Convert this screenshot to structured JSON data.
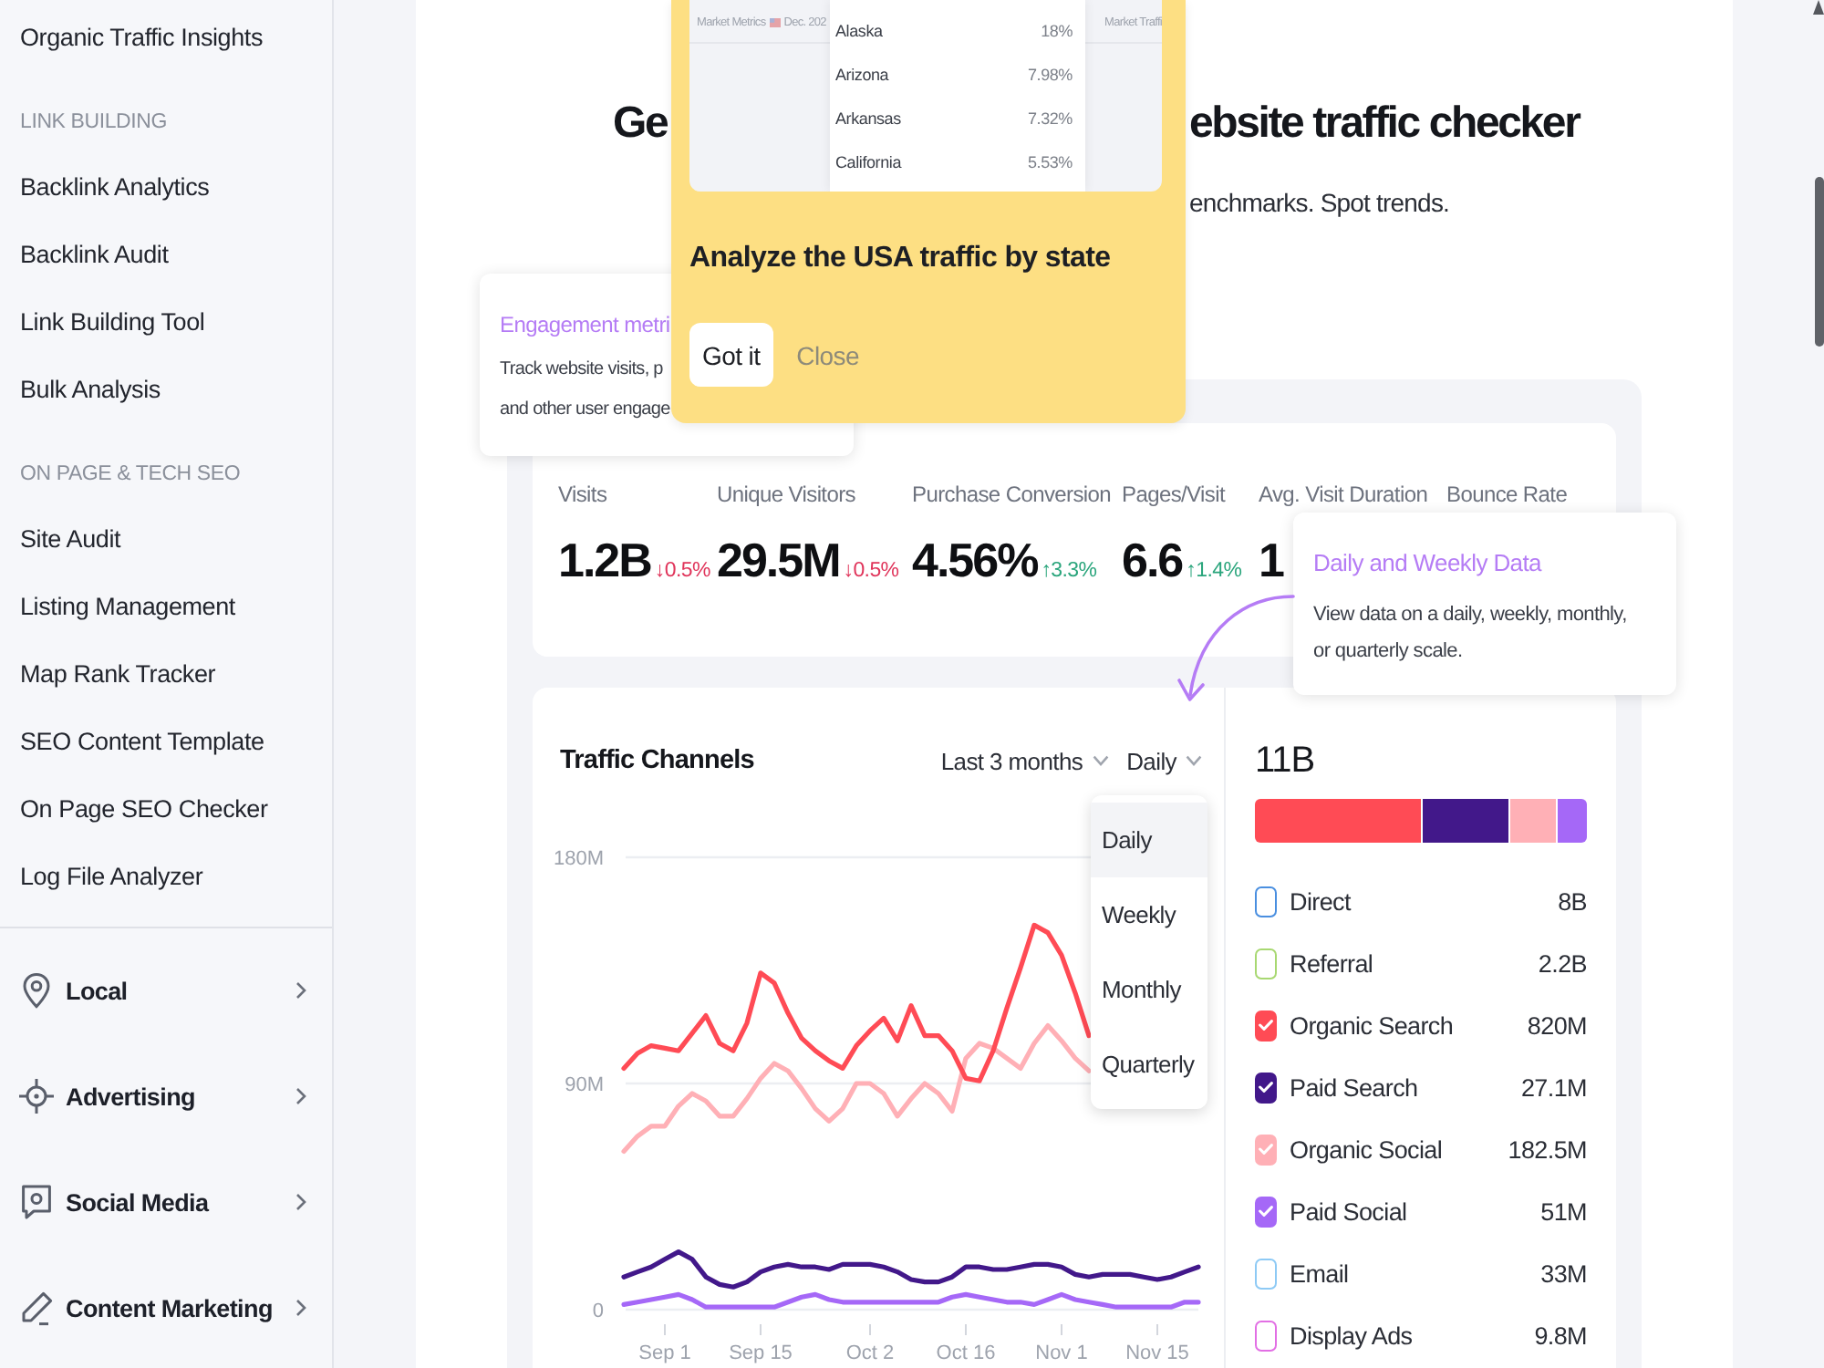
{
  "sidebar": {
    "items": [
      {
        "kind": "link",
        "label": "Organic Traffic Insights"
      },
      {
        "kind": "heading",
        "label": "LINK BUILDING"
      },
      {
        "kind": "link",
        "label": "Backlink Analytics"
      },
      {
        "kind": "link",
        "label": "Backlink Audit"
      },
      {
        "kind": "link",
        "label": "Link Building Tool"
      },
      {
        "kind": "link",
        "label": "Bulk Analysis"
      },
      {
        "kind": "heading",
        "label": "ON PAGE & TECH SEO"
      },
      {
        "kind": "link",
        "label": "Site Audit"
      },
      {
        "kind": "link",
        "label": "Listing Management"
      },
      {
        "kind": "link",
        "label": "Map Rank Tracker"
      },
      {
        "kind": "link",
        "label": "SEO Content Template"
      },
      {
        "kind": "link",
        "label": "On Page SEO Checker"
      },
      {
        "kind": "link",
        "label": "Log File Analyzer"
      }
    ],
    "categories": [
      {
        "label": "Local",
        "expanded": false
      },
      {
        "label": "Advertising",
        "expanded": false
      },
      {
        "label": "Social Media",
        "expanded": false
      },
      {
        "label": "Content Marketing",
        "expanded": false
      }
    ]
  },
  "header": {
    "title_start": "Ge",
    "title_end": "ebsite traffic checker",
    "subtitle_end": "enchmarks. Spot trends."
  },
  "onboarding_popup": {
    "preview": {
      "header_left": "Market Metrics",
      "header_date": "Dec. 202",
      "header_right": "Market Traffi",
      "states": [
        {
          "name": "Alaska",
          "share": "18%"
        },
        {
          "name": "Arizona",
          "share": "7.98%"
        },
        {
          "name": "Arkansas",
          "share": "7.32%"
        },
        {
          "name": "California",
          "share": "5.53%"
        }
      ]
    },
    "title": "Analyze the USA traffic by state",
    "primary_button": "Got it",
    "secondary_button": "Close"
  },
  "engagement_tooltip": {
    "title": "Engagement metri",
    "lines": [
      "Track website visits, p",
      "and other user engage"
    ]
  },
  "metrics": [
    {
      "label": "Visits",
      "value": "1.2B",
      "change": "↓0.5%",
      "increase": false
    },
    {
      "label": "Unique Visitors",
      "value": "29.5M",
      "change": "↓0.5%",
      "increase": false
    },
    {
      "label": "Purchase Conversion",
      "value": "4.56%",
      "change": "↑3.3%",
      "increase": true
    },
    {
      "label": "Pages/Visit",
      "value": "6.6",
      "change": "↑1.4%",
      "increase": true
    },
    {
      "label": "Avg. Visit Duration",
      "value": "1"
    },
    {
      "label": "Bounce Rate"
    }
  ],
  "data_tooltip": {
    "title": "Daily and Weekly Data",
    "body": "View data on a daily, weekly, monthly, or quarterly scale."
  },
  "traffic_channels": {
    "period": "Last 3 months",
    "granularity": "Daily",
    "granularity_menu": {
      "open": true,
      "options": [
        {
          "label": "Daily",
          "selected": true
        },
        {
          "label": "Weekly",
          "selected": false
        },
        {
          "label": "Monthly",
          "selected": false
        },
        {
          "label": "Quarterly",
          "selected": false
        }
      ]
    },
    "chart_data": {
      "type": "line",
      "title": "Traffic Channels",
      "categories": [
        null,
        null,
        null,
        "Sep 1",
        null,
        null,
        null,
        null,
        null,
        null,
        "Sep 15",
        null,
        null,
        null,
        null,
        null,
        null,
        null,
        "Oct 2",
        null,
        null,
        null,
        null,
        null,
        null,
        "Oct 16",
        null,
        null,
        null,
        null,
        null,
        null,
        "Nov 1",
        null,
        null,
        null,
        null,
        null,
        null,
        "Nov 15",
        null,
        null,
        null
      ],
      "ylim": [
        0,
        180
      ],
      "yticks": [
        {
          "value": 0,
          "label": "0"
        },
        {
          "value": 90,
          "label": "90M"
        },
        {
          "value": 180,
          "label": "180M"
        }
      ],
      "series": [
        {
          "color": "#ff4b55",
          "values": [
            96,
            102,
            105,
            104,
            103,
            110,
            117,
            106,
            103,
            114,
            134,
            130,
            118,
            108,
            103,
            99,
            96,
            105,
            111,
            116,
            107,
            121,
            109,
            109,
            103,
            92,
            91,
            103,
            120,
            136,
            153,
            150,
            141,
            126,
            109,
            null,
            null,
            null,
            null,
            null,
            null,
            null,
            null
          ]
        },
        {
          "color": "#42188a",
          "values": [
            13,
            15,
            17,
            20,
            23,
            20,
            13,
            10,
            9,
            11,
            15,
            17,
            18,
            17,
            17,
            16,
            18,
            18,
            18,
            17,
            15,
            12,
            11,
            11,
            13,
            17,
            17,
            16,
            16,
            17,
            18,
            18,
            17,
            14,
            13,
            14,
            14,
            14,
            13,
            12,
            13,
            15,
            17
          ]
        },
        {
          "color": "#ffb0b6",
          "values": [
            63,
            69,
            73,
            73,
            81,
            86,
            83,
            77,
            77,
            84,
            92,
            98,
            95,
            88,
            80,
            75,
            80,
            90,
            90,
            86,
            77,
            84,
            90,
            86,
            79,
            100,
            106,
            104,
            100,
            96,
            106,
            113,
            107,
            100,
            95,
            null,
            null,
            null,
            null,
            null,
            null,
            null,
            null
          ]
        },
        {
          "color": "#a568f7",
          "values": [
            2,
            3,
            4,
            5,
            6,
            4,
            1,
            1,
            1,
            1,
            1,
            1,
            3,
            5,
            6,
            4,
            3,
            3,
            3,
            3,
            3,
            3,
            3,
            3,
            5,
            6,
            5,
            4,
            3,
            3,
            2,
            4,
            6,
            4,
            3,
            2,
            1,
            1,
            1,
            1,
            1,
            3,
            3
          ]
        }
      ]
    },
    "total": "11B",
    "share_bar": [
      {
        "color": "#ff4b55"
      },
      {
        "color": "#42188a"
      },
      {
        "color": "#ffb0b6"
      },
      {
        "color": "#a568f7"
      }
    ],
    "channels": [
      {
        "label": "Direct",
        "value": "8B",
        "color": "#4a8fe0",
        "checked": false
      },
      {
        "label": "Referral",
        "value": "2.2B",
        "color": "#a8d872",
        "checked": false
      },
      {
        "label": "Organic Search",
        "value": "820M",
        "color": "#ff4b55",
        "checked": true
      },
      {
        "label": "Paid Search",
        "value": "27.1M",
        "color": "#42188a",
        "checked": true
      },
      {
        "label": "Organic Social",
        "value": "182.5M",
        "color": "#ffb0b6",
        "checked": true
      },
      {
        "label": "Paid Social",
        "value": "51M",
        "color": "#a568f7",
        "checked": true
      },
      {
        "label": "Email",
        "value": "33M",
        "color": "#8ecaf5",
        "checked": false
      },
      {
        "label": "Display Ads",
        "value": "9.8M",
        "color": "#e26fe4",
        "checked": false
      }
    ]
  }
}
